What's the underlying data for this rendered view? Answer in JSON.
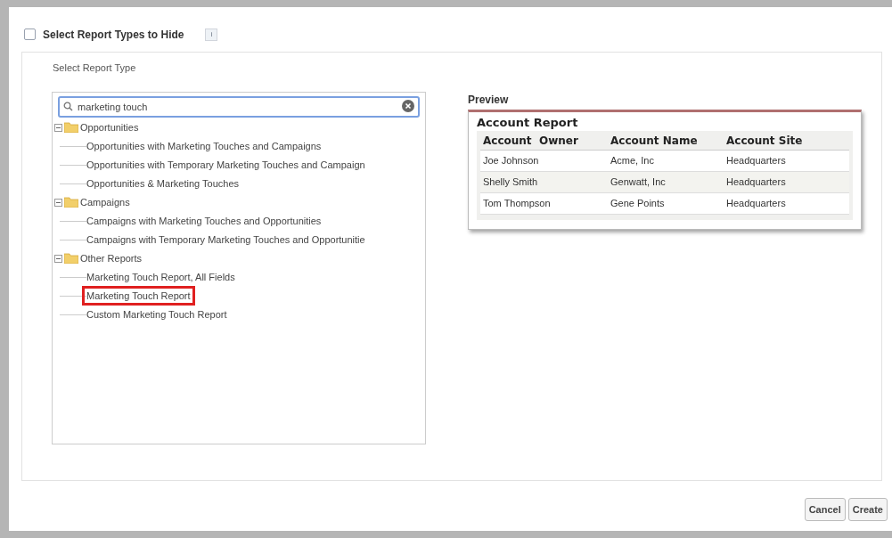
{
  "header": {
    "checked": false,
    "label": "Select Report Types to Hide",
    "info": "i"
  },
  "section_label": "Select Report Type",
  "search": {
    "value": "marketing touch"
  },
  "tree": [
    {
      "label": "Opportunities",
      "expanded": true,
      "children": [
        {
          "label": "Opportunities with Marketing Touches and Campaigns",
          "selected": false
        },
        {
          "label": "Opportunities with Temporary Marketing Touches and Campaign",
          "selected": false
        },
        {
          "label": "Opportunities & Marketing Touches",
          "selected": false
        }
      ]
    },
    {
      "label": "Campaigns",
      "expanded": true,
      "children": [
        {
          "label": "Campaigns with Marketing Touches and Opportunities",
          "selected": false
        },
        {
          "label": "Campaigns with Temporary Marketing Touches and Opportunitie",
          "selected": false
        }
      ]
    },
    {
      "label": "Other Reports",
      "expanded": true,
      "children": [
        {
          "label": "Marketing Touch Report, All Fields",
          "selected": false
        },
        {
          "label": "Marketing Touch Report",
          "selected": true
        },
        {
          "label": "Custom Marketing Touch Report",
          "selected": false
        }
      ]
    }
  ],
  "preview": {
    "title": "Preview",
    "report_title": "Account Report",
    "columns": [
      "Account  Owner",
      "Account Name",
      "Account Site"
    ],
    "rows": [
      [
        "Joe Johnson",
        "Acme, Inc",
        "Headquarters"
      ],
      [
        "Shelly Smith",
        "Genwatt, Inc",
        "Headquarters"
      ],
      [
        "Tom Thompson",
        "Gene Points",
        "Headquarters"
      ]
    ]
  },
  "buttons": [
    "Cancel",
    "Create"
  ]
}
